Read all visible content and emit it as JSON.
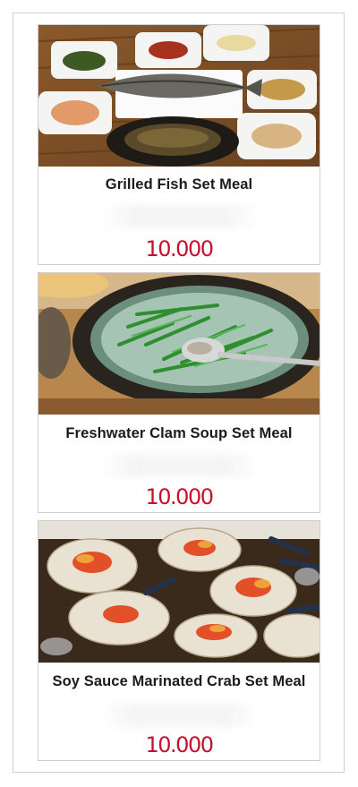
{
  "menu": [
    {
      "title": "Grilled Fish Set Meal",
      "price": "10.000",
      "photo_icon": "grilled-fish-photo"
    },
    {
      "title": "Freshwater Clam Soup Set Meal",
      "price": "10.000",
      "photo_icon": "clam-soup-photo"
    },
    {
      "title": "Soy Sauce Marinated Crab Set Meal",
      "price": "10.000",
      "photo_icon": "marinated-crab-photo"
    }
  ],
  "colors": {
    "price": "#c8102e",
    "title": "#1b1b1b",
    "border": "#cfcfcf"
  }
}
